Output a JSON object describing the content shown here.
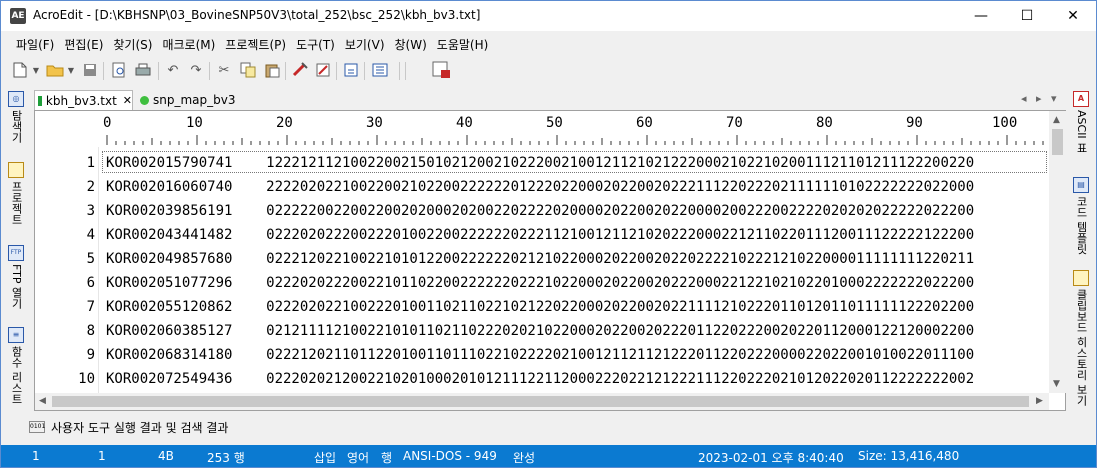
{
  "window": {
    "title": "AcroEdit - [D:\\KBHSNP\\03_BovineSNP50V3\\total_252\\bsc_252\\kbh_bv3.txt]",
    "app_icon": "AE",
    "controls": {
      "minimize": "—",
      "maximize": "☐",
      "close": "✕"
    }
  },
  "menu": [
    "파일(F)",
    "편집(E)",
    "찾기(S)",
    "매크로(M)",
    "프로젝트(P)",
    "도구(T)",
    "보기(V)",
    "창(W)",
    "도움말(H)"
  ],
  "left_panel": {
    "items": [
      {
        "label": "탐색기",
        "icon": "explorer-icon"
      },
      {
        "label": "프로젝트",
        "icon": "project-icon"
      },
      {
        "label": "FTP 열기",
        "icon": "ftp-icon",
        "badge": "FTP"
      },
      {
        "label": "함수 리스트",
        "icon": "function-list-icon"
      }
    ]
  },
  "right_panel": {
    "items": [
      {
        "label": "ASCII 표",
        "icon": "ascii-icon",
        "badge": "A"
      },
      {
        "label": "코드 템플릿",
        "icon": "code-template-icon"
      },
      {
        "label": "클립보드 히스토리 보기",
        "icon": "clipboard-icon"
      }
    ]
  },
  "tabs": [
    {
      "label": "kbh_bv3.txt",
      "close": "✕",
      "color": "#1e9e3a",
      "active": true
    },
    {
      "label": "snp_map_bv3",
      "color": "#3fbf3f",
      "active": false
    }
  ],
  "tab_nav": {
    "prev": "◂",
    "next": "▸",
    "menu": "▾"
  },
  "ruler": {
    "labels": [
      "0",
      "10",
      "20",
      "30",
      "40",
      "50",
      "60",
      "70",
      "80",
      "90",
      "100"
    ]
  },
  "rows": [
    {
      "num": "1",
      "text": "KOR002015790741    122212112100220021501021200210222002100121121021222000210221020011121101211122200220"
    },
    {
      "num": "2",
      "text": "KOR002016060740    222202022100220021022002222220122202200020220020222111220222021111110102222222022000"
    },
    {
      "num": "3",
      "text": "KOR002039856191    022222002200220020200020200220222202000020220020220000200222002222020202022222022200"
    },
    {
      "num": "4",
      "text": "KOR002043441482    022202022200222010022002222220222112100121121020222000221211022011120011122222122200"
    },
    {
      "num": "5",
      "text": "KOR002049857680    022212022100221010122002222220212102200020220020220222210222121022000011111111220211"
    },
    {
      "num": "6",
      "text": "KOR002051077296    022202022200221011022002222220222102200020220020222000221221021022010002222222022200"
    },
    {
      "num": "7",
      "text": "KOR002055120862    022202022100222010011021102210212202200020220020221111210222011012011011111122202200"
    },
    {
      "num": "8",
      "text": "KOR002060385127    021211112100221010110211022202021022000202200202220112202220020220112000122120002200"
    },
    {
      "num": "9",
      "text": "KOR002068314180    022212021101122010011011102210222202100121121121222011220222000022022001010022011100"
    },
    {
      "num": "10",
      "text": "KOR002072549436    022202021200221020100020101211122112000222022121222111220222021012022020112222222002"
    }
  ],
  "bottom_panel": {
    "label": "사용자 도구 실행 결과 및 검색 결과",
    "icon": "output-icon"
  },
  "status": {
    "line": "1",
    "col": "1",
    "bytes": "4B",
    "lines": "253 행",
    "insert": "삽입",
    "lang": "영어",
    "unit": "행",
    "encoding": "ANSI-DOS - 949",
    "state": "완성",
    "datetime": "2023-02-01 오후 8:40:40",
    "size": "Size: 13,416,480"
  },
  "colors": {
    "statusbar": "#0b7ad1",
    "accent": "#5b8bd0"
  }
}
